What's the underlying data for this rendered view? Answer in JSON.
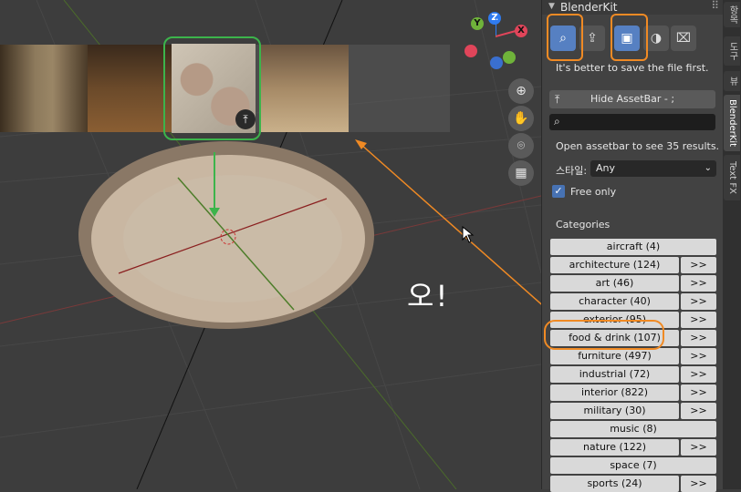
{
  "overlay": {
    "exclaim": "오!"
  },
  "gizmo": {
    "y": "Y",
    "z": "Z",
    "x": "X"
  },
  "panel": {
    "title": "BlenderKit",
    "save_hint": "It's better to save the file first.",
    "hide_assetbar_label": "Hide AssetBar - ;",
    "search_value": "",
    "results_text": "Open assetbar to see 35 results.",
    "style_label": "스타일:",
    "style_value": "Any",
    "free_only_label": "Free only",
    "free_only_checked": true,
    "categories_heading": "Categories",
    "more_label": ">>"
  },
  "categories": [
    {
      "label": "aircraft (4)",
      "more": false
    },
    {
      "label": "architecture (124)",
      "more": true
    },
    {
      "label": "art (46)",
      "more": true
    },
    {
      "label": "character (40)",
      "more": true
    },
    {
      "label": "exterior (95)",
      "more": true
    },
    {
      "label": "food & drink (107)",
      "more": true
    },
    {
      "label": "furniture (497)",
      "more": true
    },
    {
      "label": "industrial (72)",
      "more": true
    },
    {
      "label": "interior (822)",
      "more": true
    },
    {
      "label": "military (30)",
      "more": true
    },
    {
      "label": "music (8)",
      "more": false
    },
    {
      "label": "nature (122)",
      "more": true
    },
    {
      "label": "space (7)",
      "more": false
    },
    {
      "label": "sports (24)",
      "more": true
    }
  ],
  "tabs": [
    "항목",
    "도구",
    "뷰",
    "BlenderKit",
    "Text FX"
  ],
  "active_tab": "BlenderKit",
  "colors": {
    "selection_green": "#3cb44b",
    "annotation_orange": "#f08a24",
    "active_blue": "#5680c2"
  }
}
